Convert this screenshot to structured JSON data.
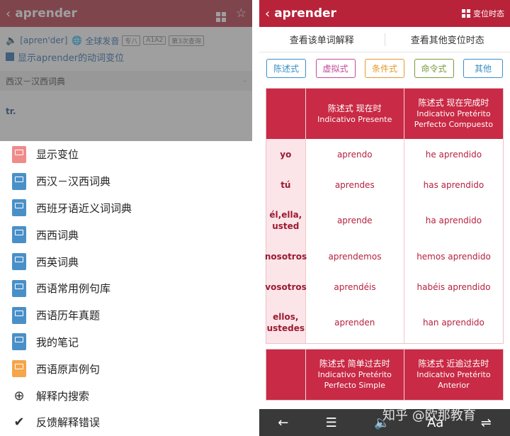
{
  "left": {
    "header": {
      "back_icon": "‹",
      "title": "aprender"
    },
    "pronunciation": {
      "phonetic": "[apren'der]",
      "global_label": "全球发音",
      "tags": [
        "专八",
        "A1A2",
        "第3次查询"
      ]
    },
    "show_conjugation": "显示aprender的动词变位",
    "dict_section": "西汉－汉西词典",
    "pos": "tr.",
    "menu": [
      {
        "label": "显示变位",
        "icon": "red"
      },
      {
        "label": "西汉－汉西词典",
        "icon": "blue"
      },
      {
        "label": "西班牙语近义词词典",
        "icon": "blue"
      },
      {
        "label": "西西词典",
        "icon": "blue"
      },
      {
        "label": "西英词典",
        "icon": "blue"
      },
      {
        "label": "西语常用例句库",
        "icon": "blue"
      },
      {
        "label": "西语历年真题",
        "icon": "blue"
      },
      {
        "label": "我的笔记",
        "icon": "blue"
      },
      {
        "label": "西语原声例句",
        "icon": "orange"
      },
      {
        "label": "解释内搜索",
        "icon": "search"
      },
      {
        "label": "反馈解释错误",
        "icon": "check"
      }
    ]
  },
  "right": {
    "header": {
      "back_icon": "‹",
      "title": "aprender",
      "conj_button": "变位时态"
    },
    "tabs": [
      "查看该单词解释",
      "查看其他变位时态"
    ],
    "moods": [
      {
        "label": "陈述式",
        "color": "#3a8fc7"
      },
      {
        "label": "虚拟式",
        "color": "#c04a9a"
      },
      {
        "label": "条件式",
        "color": "#e39a2a"
      },
      {
        "label": "命令式",
        "color": "#7a9a3a"
      },
      {
        "label": "其他",
        "color": "#3a8fc7"
      }
    ],
    "table1": {
      "headers": [
        {
          "zh": "陈述式 现在时",
          "es": "Indicativo Presente"
        },
        {
          "zh": "陈述式 现在完成时",
          "es": "Indicativo Pretérito Perfecto Compuesto"
        }
      ],
      "rows": [
        {
          "person": "yo",
          "a": "aprendo",
          "b": "he aprendido"
        },
        {
          "person": "tú",
          "a": "aprendes",
          "b": "has aprendido"
        },
        {
          "person": "él,ella, usted",
          "a": "aprende",
          "b": "ha aprendido"
        },
        {
          "person": "nosotros",
          "a": "aprendemos",
          "b": "hemos aprendido"
        },
        {
          "person": "vosotros",
          "a": "aprendéis",
          "b": "habéis aprendido"
        },
        {
          "person": "ellos, ustedes",
          "a": "aprenden",
          "b": "han aprendido"
        }
      ]
    },
    "table2": {
      "headers": [
        {
          "zh": "陈述式 简单过去时",
          "es": "Indicativo Pretérito Perfecto Simple"
        },
        {
          "zh": "陈述式 近逾过去时",
          "es": "Indicativo Pretérito Anterior"
        }
      ]
    },
    "bottom_bar": {
      "back": "←",
      "menu": "☰",
      "speaker": "🔈",
      "font": "Aa",
      "more": "⇌"
    }
  },
  "watermark": "知乎 @欧那教育"
}
